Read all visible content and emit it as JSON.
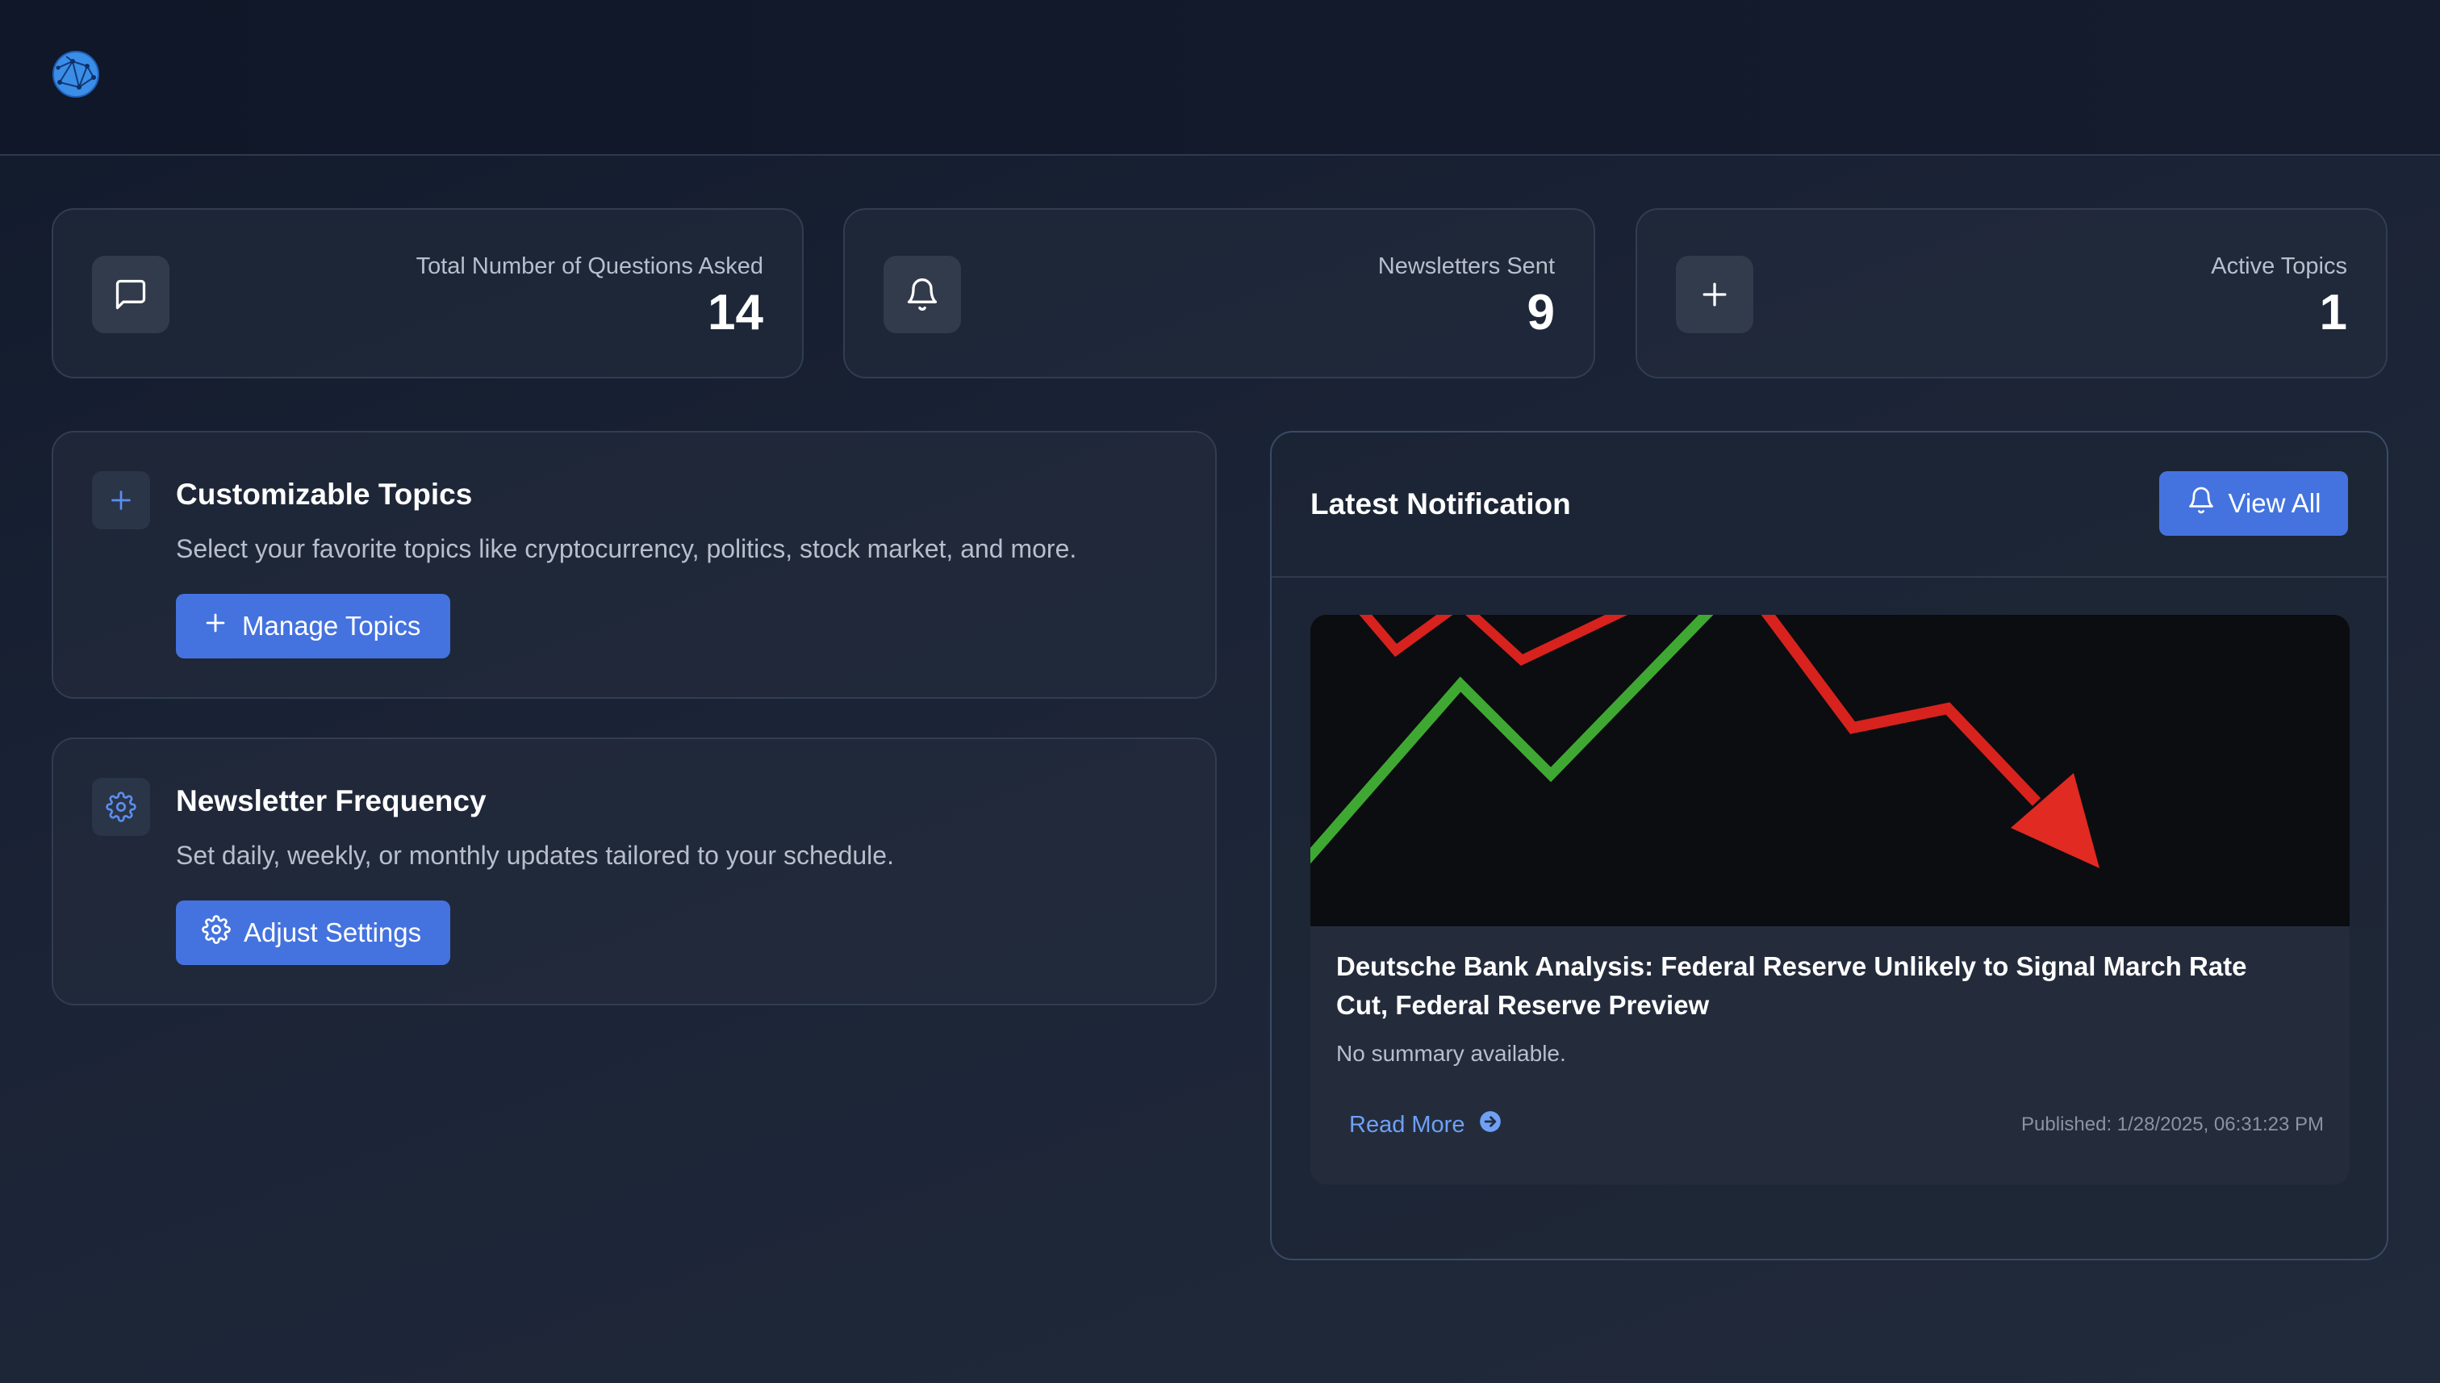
{
  "header": {
    "logo_icon": "globe-icon"
  },
  "stats": [
    {
      "label": "Total Number of Questions Asked",
      "value": "14",
      "icon": "message-square-icon"
    },
    {
      "label": "Newsletters Sent",
      "value": "9",
      "icon": "bell-icon"
    },
    {
      "label": "Active Topics",
      "value": "1",
      "icon": "plus-icon"
    }
  ],
  "features": {
    "topics": {
      "title": "Customizable Topics",
      "description": "Select your favorite topics like cryptocurrency, politics, stock market, and more.",
      "button_label": "Manage Topics",
      "icon": "plus-icon"
    },
    "frequency": {
      "title": "Newsletter Frequency",
      "description": "Set daily, weekly, or monthly updates tailored to your schedule.",
      "button_label": "Adjust Settings",
      "icon": "gear-icon"
    }
  },
  "notification": {
    "title": "Latest Notification",
    "view_all_label": "View All",
    "article": {
      "title": "Deutsche Bank Analysis: Federal Reserve Unlikely to Signal March Rate Cut, Federal Reserve Preview",
      "summary": "No summary available.",
      "read_more_label": "Read More",
      "published": "Published: 1/28/2025, 06:31:23 PM",
      "image": "stock-chart-red-arrow-down"
    }
  },
  "colors": {
    "accent": "#4473e0",
    "link": "#6fa0f5",
    "card_bg": "#252e3e",
    "page_bg": "#1b2436"
  }
}
